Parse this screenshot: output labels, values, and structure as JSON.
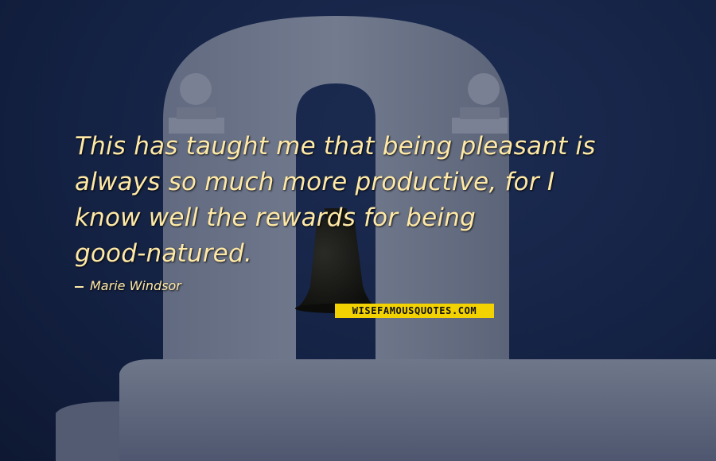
{
  "quote": {
    "lines": [
      "This has taught me that being pleasant is",
      "always so much more productive, for I",
      "know well the rewards for being",
      "good-natured."
    ],
    "author": "Marie Windsor"
  },
  "watermark": "WISEFAMOUSQUOTES.COM",
  "colors": {
    "sky": "#142244",
    "quote_text": "#ffe9a6",
    "watermark_bg": "#f2d200"
  }
}
